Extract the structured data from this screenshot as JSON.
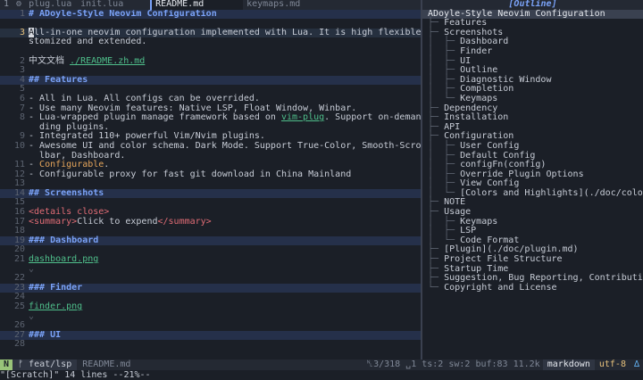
{
  "tabs": {
    "num": "1",
    "items": [
      {
        "label": "plug.lua"
      },
      {
        "label": "init.lua"
      },
      {
        "label": "README.md"
      },
      {
        "label": "keymaps.md"
      }
    ]
  },
  "editor": {
    "title": "ADoyle-Style Neovim Configuration",
    "lines": [
      {
        "n": "1",
        "text": "# ADoyle-Style Neovim Configuration"
      },
      {
        "n": "",
        "text": ""
      },
      {
        "n": "3",
        "cursor_char": "A",
        "text": "ll-in-one neovim configuration implemented with Lua. It is high flexible to be cu"
      },
      {
        "n": "",
        "text": "stomized and extended."
      },
      {
        "n": "",
        "text": ""
      },
      {
        "n": "2",
        "prefix": "中文文档 ",
        "link": "./README.zh.md"
      },
      {
        "n": "3",
        "text": ""
      },
      {
        "n": "4",
        "text": "## Features"
      },
      {
        "n": "5",
        "text": ""
      },
      {
        "n": "6",
        "text": "- All in Lua. All configs can be overrided."
      },
      {
        "n": "7",
        "text": "- Use many Neovim features: Native LSP, Float Window, Winbar."
      },
      {
        "n": "8",
        "prefix": "- Lua-wrapped plugin manage framework based on ",
        "link": "vim-plug",
        "suffix": ". Support on-demand loa"
      },
      {
        "n": "",
        "text": "  ding plugins."
      },
      {
        "n": "9",
        "text": "- Integrated 110+ powerful Vim/Nvim plugins."
      },
      {
        "n": "10",
        "text": "- Awesome UI and color schema. Dark Mode. Support True-Color, Smooth-Scroll, Scrol"
      },
      {
        "n": "",
        "text": "  lbar, Dashboard."
      },
      {
        "n": "11",
        "prefix": "- ",
        "orange": "Configurable",
        "suffix": "."
      },
      {
        "n": "12",
        "text": "- Configurable proxy for fast git download in China Mainland"
      },
      {
        "n": "13",
        "text": ""
      },
      {
        "n": "14",
        "text": "## Screenshots"
      },
      {
        "n": "15",
        "text": ""
      },
      {
        "n": "16",
        "tag1": "<details close>",
        "text": ""
      },
      {
        "n": "17",
        "tag1": "<summary>",
        "text": "Click to expend",
        "tag2": "</summary>"
      },
      {
        "n": "18",
        "text": ""
      },
      {
        "n": "19",
        "text": "### Dashboard"
      },
      {
        "n": "20",
        "text": ""
      },
      {
        "n": "21",
        "link": "dashboard.png"
      },
      {
        "n": "",
        "dim": "⌄"
      },
      {
        "n": "22",
        "text": ""
      },
      {
        "n": "23",
        "text": "### Finder"
      },
      {
        "n": "24",
        "text": ""
      },
      {
        "n": "25",
        "link": "finder.png"
      },
      {
        "n": "",
        "dim": "⌄"
      },
      {
        "n": "26",
        "text": ""
      },
      {
        "n": "27",
        "text": "### UI"
      },
      {
        "n": "28",
        "text": ""
      }
    ]
  },
  "outline": {
    "title": "[Outline]",
    "items": [
      {
        "label": "ADoyle-Style Neovim Configuration",
        "tree": "",
        "sel": true
      },
      {
        "label": "Features",
        "tree": "├─ "
      },
      {
        "label": "Screenshots",
        "tree": "├─ "
      },
      {
        "label": "Dashboard",
        "tree": "│  ├─ "
      },
      {
        "label": "Finder",
        "tree": "│  ├─ "
      },
      {
        "label": "UI",
        "tree": "│  ├─ "
      },
      {
        "label": "Outline",
        "tree": "│  ├─ "
      },
      {
        "label": "Diagnostic Window",
        "tree": "│  ├─ "
      },
      {
        "label": "Completion",
        "tree": "│  ├─ "
      },
      {
        "label": "Keymaps",
        "tree": "│  └─ "
      },
      {
        "label": "Dependency",
        "tree": "├─ "
      },
      {
        "label": "Installation",
        "tree": "├─ "
      },
      {
        "label": "API",
        "tree": "├─ "
      },
      {
        "label": "Configuration",
        "tree": "├─ "
      },
      {
        "label": "User Config",
        "tree": "│  ├─ "
      },
      {
        "label": "Default Config",
        "tree": "│  ├─ "
      },
      {
        "label": "configFn(config)",
        "tree": "│  ├─ "
      },
      {
        "label": "Override Plugin Options",
        "tree": "│  ├─ "
      },
      {
        "label": "View Config",
        "tree": "│  ├─ "
      },
      {
        "label": "[Colors and Highlights](./doc/colors.md)",
        "tree": "│  └─ "
      },
      {
        "label": "NOTE",
        "tree": "├─ "
      },
      {
        "label": "Usage",
        "tree": "├─ "
      },
      {
        "label": "Keymaps",
        "tree": "│  ├─ "
      },
      {
        "label": "LSP",
        "tree": "│  ├─ "
      },
      {
        "label": "Code Format",
        "tree": "│  └─ "
      },
      {
        "label": "[Plugin](./doc/plugin.md)",
        "tree": "├─ "
      },
      {
        "label": "Project File Structure",
        "tree": "├─ "
      },
      {
        "label": "Startup Time",
        "tree": "├─ "
      },
      {
        "label": "Suggestion, Bug Reporting, Contributing",
        "tree": "├─ "
      },
      {
        "label": "Copyright and License",
        "tree": "└─ "
      }
    ]
  },
  "status": {
    "mode": "N",
    "branch": "ᚠ feat/lsp",
    "file": "README.md",
    "pos": "␤3/318 ␣1 ts:2 sw:2 buf:83",
    "size": "11.2k",
    "filetype": "markdown",
    "encoding": "utf-8",
    "fileformat": "∆"
  },
  "cmdline": "\"[Scratch]\" 14 lines --21%--"
}
